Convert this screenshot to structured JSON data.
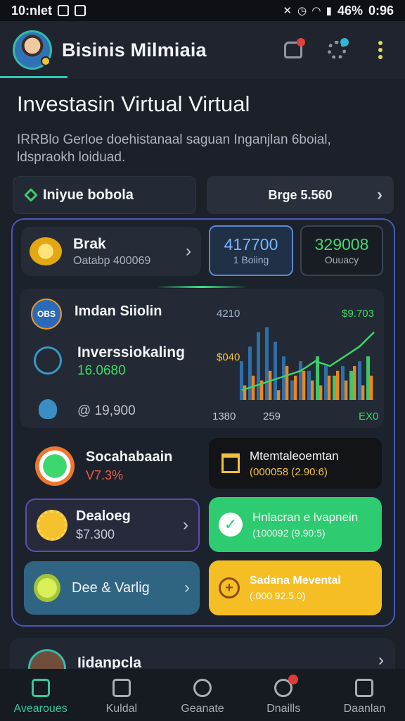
{
  "status_bar": {
    "time": "10:nlet",
    "battery": "46%",
    "clock": "0:96"
  },
  "header": {
    "title": "Bisinis Milmiaia"
  },
  "page": {
    "title": "Investasin Virtual Virtual",
    "description": "IRRBlo Gerloe doehistanaal saguan Inganjlan 6boial, ldspraokh loiduad."
  },
  "chips": {
    "left_label": "Iniyue bobola",
    "right_label": "Brge 5.560"
  },
  "bank_card": {
    "title": "Brak",
    "subtitle": "Oatabp 400069"
  },
  "stats": [
    {
      "value": "417700",
      "label": "1 Boiing"
    },
    {
      "value": "329008",
      "label": "Ouuacy"
    }
  ],
  "analytics": {
    "title": "Imdan Siiolin",
    "row2_title": "Inverssiokaling",
    "row2_value": "16.0680",
    "row3_value": "@ 19,900",
    "icon_text": "OBS"
  },
  "chart_data": {
    "type": "bar",
    "title": "",
    "labels": {
      "top_left": "4210",
      "top_right": "$9.703",
      "mid_left": "$040"
    },
    "categories": [
      "1380",
      "259",
      "",
      "",
      "",
      "",
      "",
      "",
      "",
      "",
      "",
      "",
      "",
      "",
      "EX0"
    ],
    "series": [
      {
        "values": [
          8,
          11,
          14,
          15,
          12,
          9,
          4,
          8,
          6,
          9,
          7,
          5,
          7,
          6,
          8,
          9
        ]
      },
      {
        "values": [
          3,
          5,
          4,
          6,
          2,
          7,
          5,
          6,
          4,
          3,
          5,
          6,
          4,
          7,
          3,
          5
        ]
      }
    ],
    "trend": [
      2,
      3,
      4,
      5,
      6,
      8,
      7,
      9,
      11,
      14
    ],
    "colors": {
      "blue": "#2e6fa8",
      "orange": "#f0851d",
      "green": "#37c96a",
      "trend": "#3fd468"
    }
  },
  "tiles": {
    "social": {
      "title": "Socahabaain",
      "value": "V7.3%"
    },
    "monetal": {
      "title": "Mtemtaleoemtan",
      "value": "(000058 (2.90:6)"
    },
    "dealog": {
      "title": "Dealoeg",
      "value": "$7.300"
    },
    "installment": {
      "title": "Hnlacran e lvapnein",
      "value": "(100092 (9.90:5)"
    },
    "dee": {
      "title": "Dee & Varlig"
    },
    "savings": {
      "title": "Sadana Mevental",
      "value": "(.000 92.5.0)"
    }
  },
  "bottom_card": {
    "title": "Iidanpcla"
  },
  "nav": [
    {
      "label": "Avearoues"
    },
    {
      "label": "Kuldal"
    },
    {
      "label": "Geanate"
    },
    {
      "label": "Dnaills"
    },
    {
      "label": "Daanlan"
    }
  ],
  "colors": {
    "accent": "#35c7b8",
    "green": "#2ecc71",
    "yellow": "#f5be24",
    "panel_border": "#4b57b8"
  }
}
